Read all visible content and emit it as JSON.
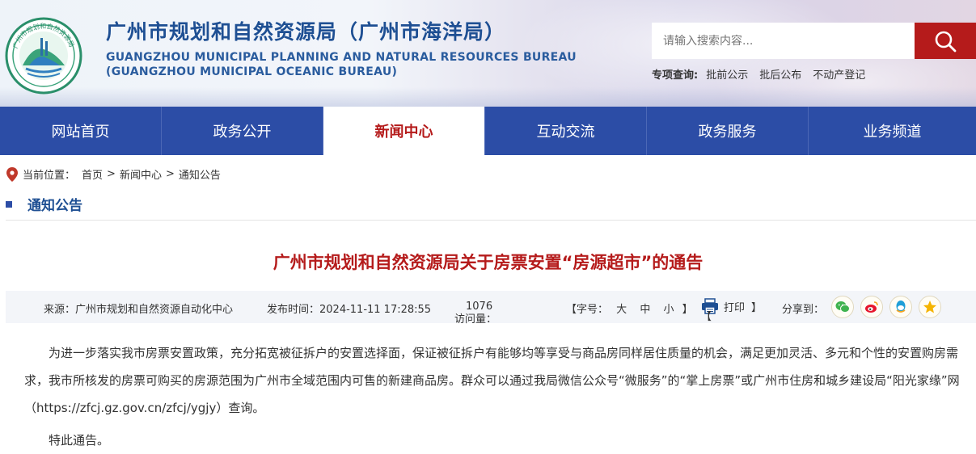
{
  "header": {
    "title_cn": "广州市规划和自然资源局（广州市海洋局）",
    "title_en_line1": "GUANGZHOU MUNICIPAL PLANNING AND NATURAL RESOURCES BUREAU",
    "title_en_line2": "(GUANGZHOU MUNICIPAL OCEANIC BUREAU)",
    "logo_text": "广州市规划和自然资源局"
  },
  "search": {
    "placeholder": "请输入搜索内容...",
    "icon": "search-icon"
  },
  "special_query": {
    "label": "专项查询:",
    "links": [
      "批前公示",
      "批后公布",
      "不动产登记"
    ]
  },
  "nav": {
    "items": [
      {
        "label": "网站首页"
      },
      {
        "label": "政务公开"
      },
      {
        "label": "新闻中心",
        "active": true
      },
      {
        "label": "互动交流"
      },
      {
        "label": "政务服务"
      },
      {
        "label": "业务频道"
      }
    ],
    "bg_color": "#2c4da6",
    "active_color": "#b51b1b"
  },
  "breadcrumb": {
    "prefix": "当前位置：",
    "items": [
      "首页",
      "新闻中心",
      "通知公告"
    ],
    "separator": ">"
  },
  "section": {
    "title": "通知公告"
  },
  "article": {
    "title": "广州市规划和自然资源局关于房票安置“房源超市”的通告",
    "meta": {
      "source": "来源：广州市规划和自然资源自动化中心",
      "time": "发布时间：2024-11-11 17:28:55",
      "views_label": "访问量：",
      "views": "1076",
      "font_label": "【字号：",
      "font_sizes": [
        "大",
        "中",
        "小"
      ],
      "font_close": "】",
      "print_open": "【",
      "print_label": "打印",
      "print_close": "】",
      "share_label": "分享到："
    },
    "share_icons": [
      "wechat-icon",
      "weibo-icon",
      "qq-icon",
      "qzone-icon"
    ],
    "paragraphs": [
      "为进一步落实我市房票安置政策，充分拓宽被征拆户的安置选择面，保证被征拆户有能够均等享受与商品房同样居住质量的机会，满足更加灵活、多元和个性的安置购房需求，我市所核发的房票可购买的房源范围为广州市全域范围内可售的新建商品房。群众可以通过我局微信公众号“微服务”的“掌上房票”或广州市住房和城乡建设局“阳光家缘”网（https://zfcj.gz.gov.cn/zfcj/ygjy）查询。",
      "特此通告。"
    ]
  }
}
